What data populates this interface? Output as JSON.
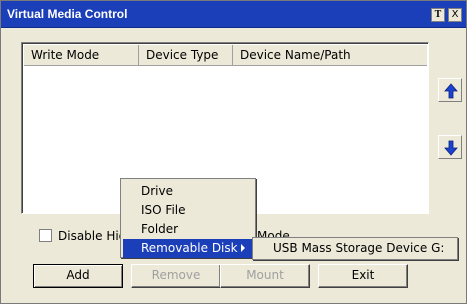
{
  "window": {
    "title": "Virtual Media Control",
    "title_buttons": {
      "t_label": "T",
      "close_label": "X"
    }
  },
  "list": {
    "columns": [
      "Write Mode",
      "Device Type",
      "Device Name/Path"
    ],
    "rows": []
  },
  "side_buttons": {
    "up_icon": "arrow-up",
    "down_icon": "arrow-down",
    "accent": "#1a44d0"
  },
  "options": {
    "disable_label": "Disable Hig",
    "mode_label": "Mode",
    "checked": false
  },
  "buttons": {
    "add": "Add",
    "remove": "Remove",
    "mount": "Mount",
    "exit": "Exit"
  },
  "context_menu": {
    "items": [
      "Drive",
      "ISO File",
      "Folder",
      "Removable Disk"
    ],
    "highlighted_index": 3,
    "submenu_items": [
      "USB Mass Storage Device G:"
    ]
  },
  "colors": {
    "titlebar": "#1b3fb8",
    "highlight": "#1b3fb8",
    "window_bg": "#ece9d8"
  }
}
